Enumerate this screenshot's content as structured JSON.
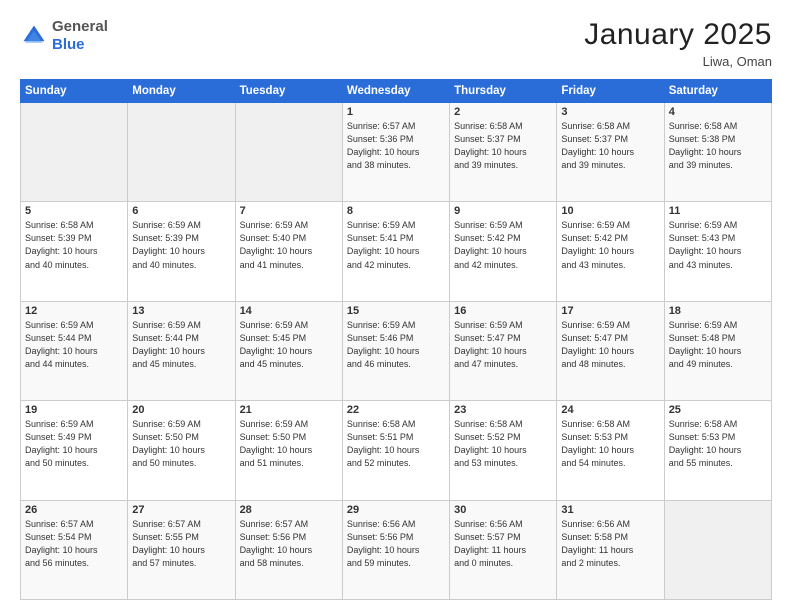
{
  "header": {
    "logo_general": "General",
    "logo_blue": "Blue",
    "month_title": "January 2025",
    "location": "Liwa, Oman"
  },
  "days_of_week": [
    "Sunday",
    "Monday",
    "Tuesday",
    "Wednesday",
    "Thursday",
    "Friday",
    "Saturday"
  ],
  "weeks": [
    [
      {
        "day": "",
        "lines": []
      },
      {
        "day": "",
        "lines": []
      },
      {
        "day": "",
        "lines": []
      },
      {
        "day": "1",
        "lines": [
          "Sunrise: 6:57 AM",
          "Sunset: 5:36 PM",
          "Daylight: 10 hours",
          "and 38 minutes."
        ]
      },
      {
        "day": "2",
        "lines": [
          "Sunrise: 6:58 AM",
          "Sunset: 5:37 PM",
          "Daylight: 10 hours",
          "and 39 minutes."
        ]
      },
      {
        "day": "3",
        "lines": [
          "Sunrise: 6:58 AM",
          "Sunset: 5:37 PM",
          "Daylight: 10 hours",
          "and 39 minutes."
        ]
      },
      {
        "day": "4",
        "lines": [
          "Sunrise: 6:58 AM",
          "Sunset: 5:38 PM",
          "Daylight: 10 hours",
          "and 39 minutes."
        ]
      }
    ],
    [
      {
        "day": "5",
        "lines": [
          "Sunrise: 6:58 AM",
          "Sunset: 5:39 PM",
          "Daylight: 10 hours",
          "and 40 minutes."
        ]
      },
      {
        "day": "6",
        "lines": [
          "Sunrise: 6:59 AM",
          "Sunset: 5:39 PM",
          "Daylight: 10 hours",
          "and 40 minutes."
        ]
      },
      {
        "day": "7",
        "lines": [
          "Sunrise: 6:59 AM",
          "Sunset: 5:40 PM",
          "Daylight: 10 hours",
          "and 41 minutes."
        ]
      },
      {
        "day": "8",
        "lines": [
          "Sunrise: 6:59 AM",
          "Sunset: 5:41 PM",
          "Daylight: 10 hours",
          "and 42 minutes."
        ]
      },
      {
        "day": "9",
        "lines": [
          "Sunrise: 6:59 AM",
          "Sunset: 5:42 PM",
          "Daylight: 10 hours",
          "and 42 minutes."
        ]
      },
      {
        "day": "10",
        "lines": [
          "Sunrise: 6:59 AM",
          "Sunset: 5:42 PM",
          "Daylight: 10 hours",
          "and 43 minutes."
        ]
      },
      {
        "day": "11",
        "lines": [
          "Sunrise: 6:59 AM",
          "Sunset: 5:43 PM",
          "Daylight: 10 hours",
          "and 43 minutes."
        ]
      }
    ],
    [
      {
        "day": "12",
        "lines": [
          "Sunrise: 6:59 AM",
          "Sunset: 5:44 PM",
          "Daylight: 10 hours",
          "and 44 minutes."
        ]
      },
      {
        "day": "13",
        "lines": [
          "Sunrise: 6:59 AM",
          "Sunset: 5:44 PM",
          "Daylight: 10 hours",
          "and 45 minutes."
        ]
      },
      {
        "day": "14",
        "lines": [
          "Sunrise: 6:59 AM",
          "Sunset: 5:45 PM",
          "Daylight: 10 hours",
          "and 45 minutes."
        ]
      },
      {
        "day": "15",
        "lines": [
          "Sunrise: 6:59 AM",
          "Sunset: 5:46 PM",
          "Daylight: 10 hours",
          "and 46 minutes."
        ]
      },
      {
        "day": "16",
        "lines": [
          "Sunrise: 6:59 AM",
          "Sunset: 5:47 PM",
          "Daylight: 10 hours",
          "and 47 minutes."
        ]
      },
      {
        "day": "17",
        "lines": [
          "Sunrise: 6:59 AM",
          "Sunset: 5:47 PM",
          "Daylight: 10 hours",
          "and 48 minutes."
        ]
      },
      {
        "day": "18",
        "lines": [
          "Sunrise: 6:59 AM",
          "Sunset: 5:48 PM",
          "Daylight: 10 hours",
          "and 49 minutes."
        ]
      }
    ],
    [
      {
        "day": "19",
        "lines": [
          "Sunrise: 6:59 AM",
          "Sunset: 5:49 PM",
          "Daylight: 10 hours",
          "and 50 minutes."
        ]
      },
      {
        "day": "20",
        "lines": [
          "Sunrise: 6:59 AM",
          "Sunset: 5:50 PM",
          "Daylight: 10 hours",
          "and 50 minutes."
        ]
      },
      {
        "day": "21",
        "lines": [
          "Sunrise: 6:59 AM",
          "Sunset: 5:50 PM",
          "Daylight: 10 hours",
          "and 51 minutes."
        ]
      },
      {
        "day": "22",
        "lines": [
          "Sunrise: 6:58 AM",
          "Sunset: 5:51 PM",
          "Daylight: 10 hours",
          "and 52 minutes."
        ]
      },
      {
        "day": "23",
        "lines": [
          "Sunrise: 6:58 AM",
          "Sunset: 5:52 PM",
          "Daylight: 10 hours",
          "and 53 minutes."
        ]
      },
      {
        "day": "24",
        "lines": [
          "Sunrise: 6:58 AM",
          "Sunset: 5:53 PM",
          "Daylight: 10 hours",
          "and 54 minutes."
        ]
      },
      {
        "day": "25",
        "lines": [
          "Sunrise: 6:58 AM",
          "Sunset: 5:53 PM",
          "Daylight: 10 hours",
          "and 55 minutes."
        ]
      }
    ],
    [
      {
        "day": "26",
        "lines": [
          "Sunrise: 6:57 AM",
          "Sunset: 5:54 PM",
          "Daylight: 10 hours",
          "and 56 minutes."
        ]
      },
      {
        "day": "27",
        "lines": [
          "Sunrise: 6:57 AM",
          "Sunset: 5:55 PM",
          "Daylight: 10 hours",
          "and 57 minutes."
        ]
      },
      {
        "day": "28",
        "lines": [
          "Sunrise: 6:57 AM",
          "Sunset: 5:56 PM",
          "Daylight: 10 hours",
          "and 58 minutes."
        ]
      },
      {
        "day": "29",
        "lines": [
          "Sunrise: 6:56 AM",
          "Sunset: 5:56 PM",
          "Daylight: 10 hours",
          "and 59 minutes."
        ]
      },
      {
        "day": "30",
        "lines": [
          "Sunrise: 6:56 AM",
          "Sunset: 5:57 PM",
          "Daylight: 11 hours",
          "and 0 minutes."
        ]
      },
      {
        "day": "31",
        "lines": [
          "Sunrise: 6:56 AM",
          "Sunset: 5:58 PM",
          "Daylight: 11 hours",
          "and 2 minutes."
        ]
      },
      {
        "day": "",
        "lines": []
      }
    ]
  ]
}
